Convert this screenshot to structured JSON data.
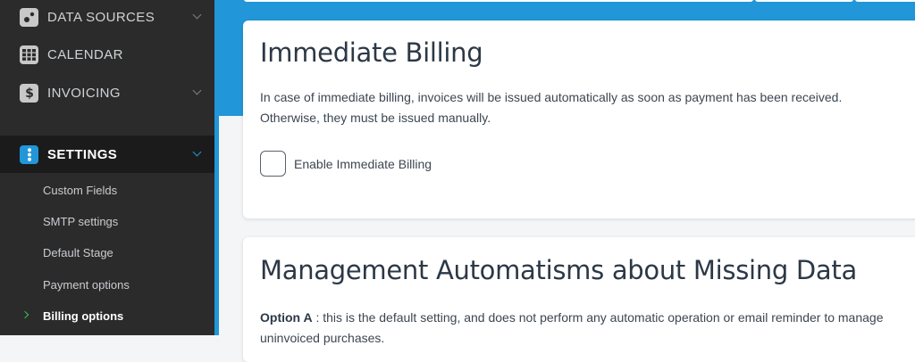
{
  "sidebar": {
    "items": [
      {
        "label": "DATA SOURCES",
        "icon": "data-sources-icon"
      },
      {
        "label": "CALENDAR",
        "icon": "calendar-icon"
      },
      {
        "label": "INVOICING",
        "icon": "dollar-icon"
      },
      {
        "label": "SETTINGS",
        "icon": "settings-icon"
      }
    ],
    "sub_items": [
      {
        "label": "Custom Fields"
      },
      {
        "label": "SMTP settings"
      },
      {
        "label": "Default Stage"
      },
      {
        "label": "Payment options"
      },
      {
        "label": "Billing options"
      }
    ],
    "accent_color": "#2196d8",
    "current_marker_color": "#36c25c"
  },
  "immediate_billing": {
    "title": "Immediate Billing",
    "description_line1": "In case of immediate billing, invoices will be issued automatically as soon as payment has been received.",
    "description_line2": "Otherwise, they must be issued manually.",
    "checkbox_label": "Enable Immediate Billing",
    "checked": false
  },
  "missing_data": {
    "title": "Management Automatisms about Missing Data",
    "option_a_label": "Option A",
    "option_a_text": " : this is the default setting, and does not perform any automatic operation or email reminder to manage uninvoiced purchases."
  }
}
